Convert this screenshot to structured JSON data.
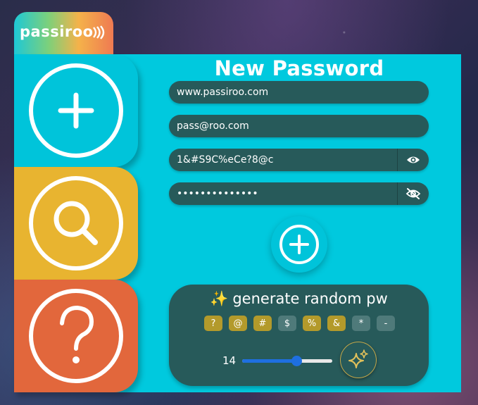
{
  "app": {
    "logo_text": "passiroo"
  },
  "sidebar": {
    "items": [
      {
        "name": "add",
        "icon": "plus-icon",
        "color": "#00c4da"
      },
      {
        "name": "search",
        "icon": "search-icon",
        "color": "#e8b430"
      },
      {
        "name": "help",
        "icon": "question-icon",
        "color": "#e2673c"
      }
    ]
  },
  "form": {
    "title": "New Password",
    "website": {
      "value": "www.passiroo.com"
    },
    "username": {
      "value": "pass@roo.com"
    },
    "password_visible": {
      "value": "1&#S9C%eCe?8@c"
    },
    "password_hidden": {
      "value": "••••••••••••••"
    }
  },
  "generator": {
    "title_emoji": "✨",
    "title": "generate random pw",
    "chips": [
      {
        "label": "?",
        "enabled": true
      },
      {
        "label": "@",
        "enabled": true
      },
      {
        "label": "#",
        "enabled": true
      },
      {
        "label": "$",
        "enabled": false
      },
      {
        "label": "%",
        "enabled": true
      },
      {
        "label": "&",
        "enabled": true
      },
      {
        "label": "*",
        "enabled": false
      },
      {
        "label": "-",
        "enabled": false
      }
    ],
    "length": "14",
    "length_fraction": 0.6
  },
  "colors": {
    "panel": "#00c9de",
    "field": "#275a5a",
    "chip_on": "#b39a2b",
    "chip_off": "#4f7a7a",
    "slider": "#1e6fe0"
  }
}
